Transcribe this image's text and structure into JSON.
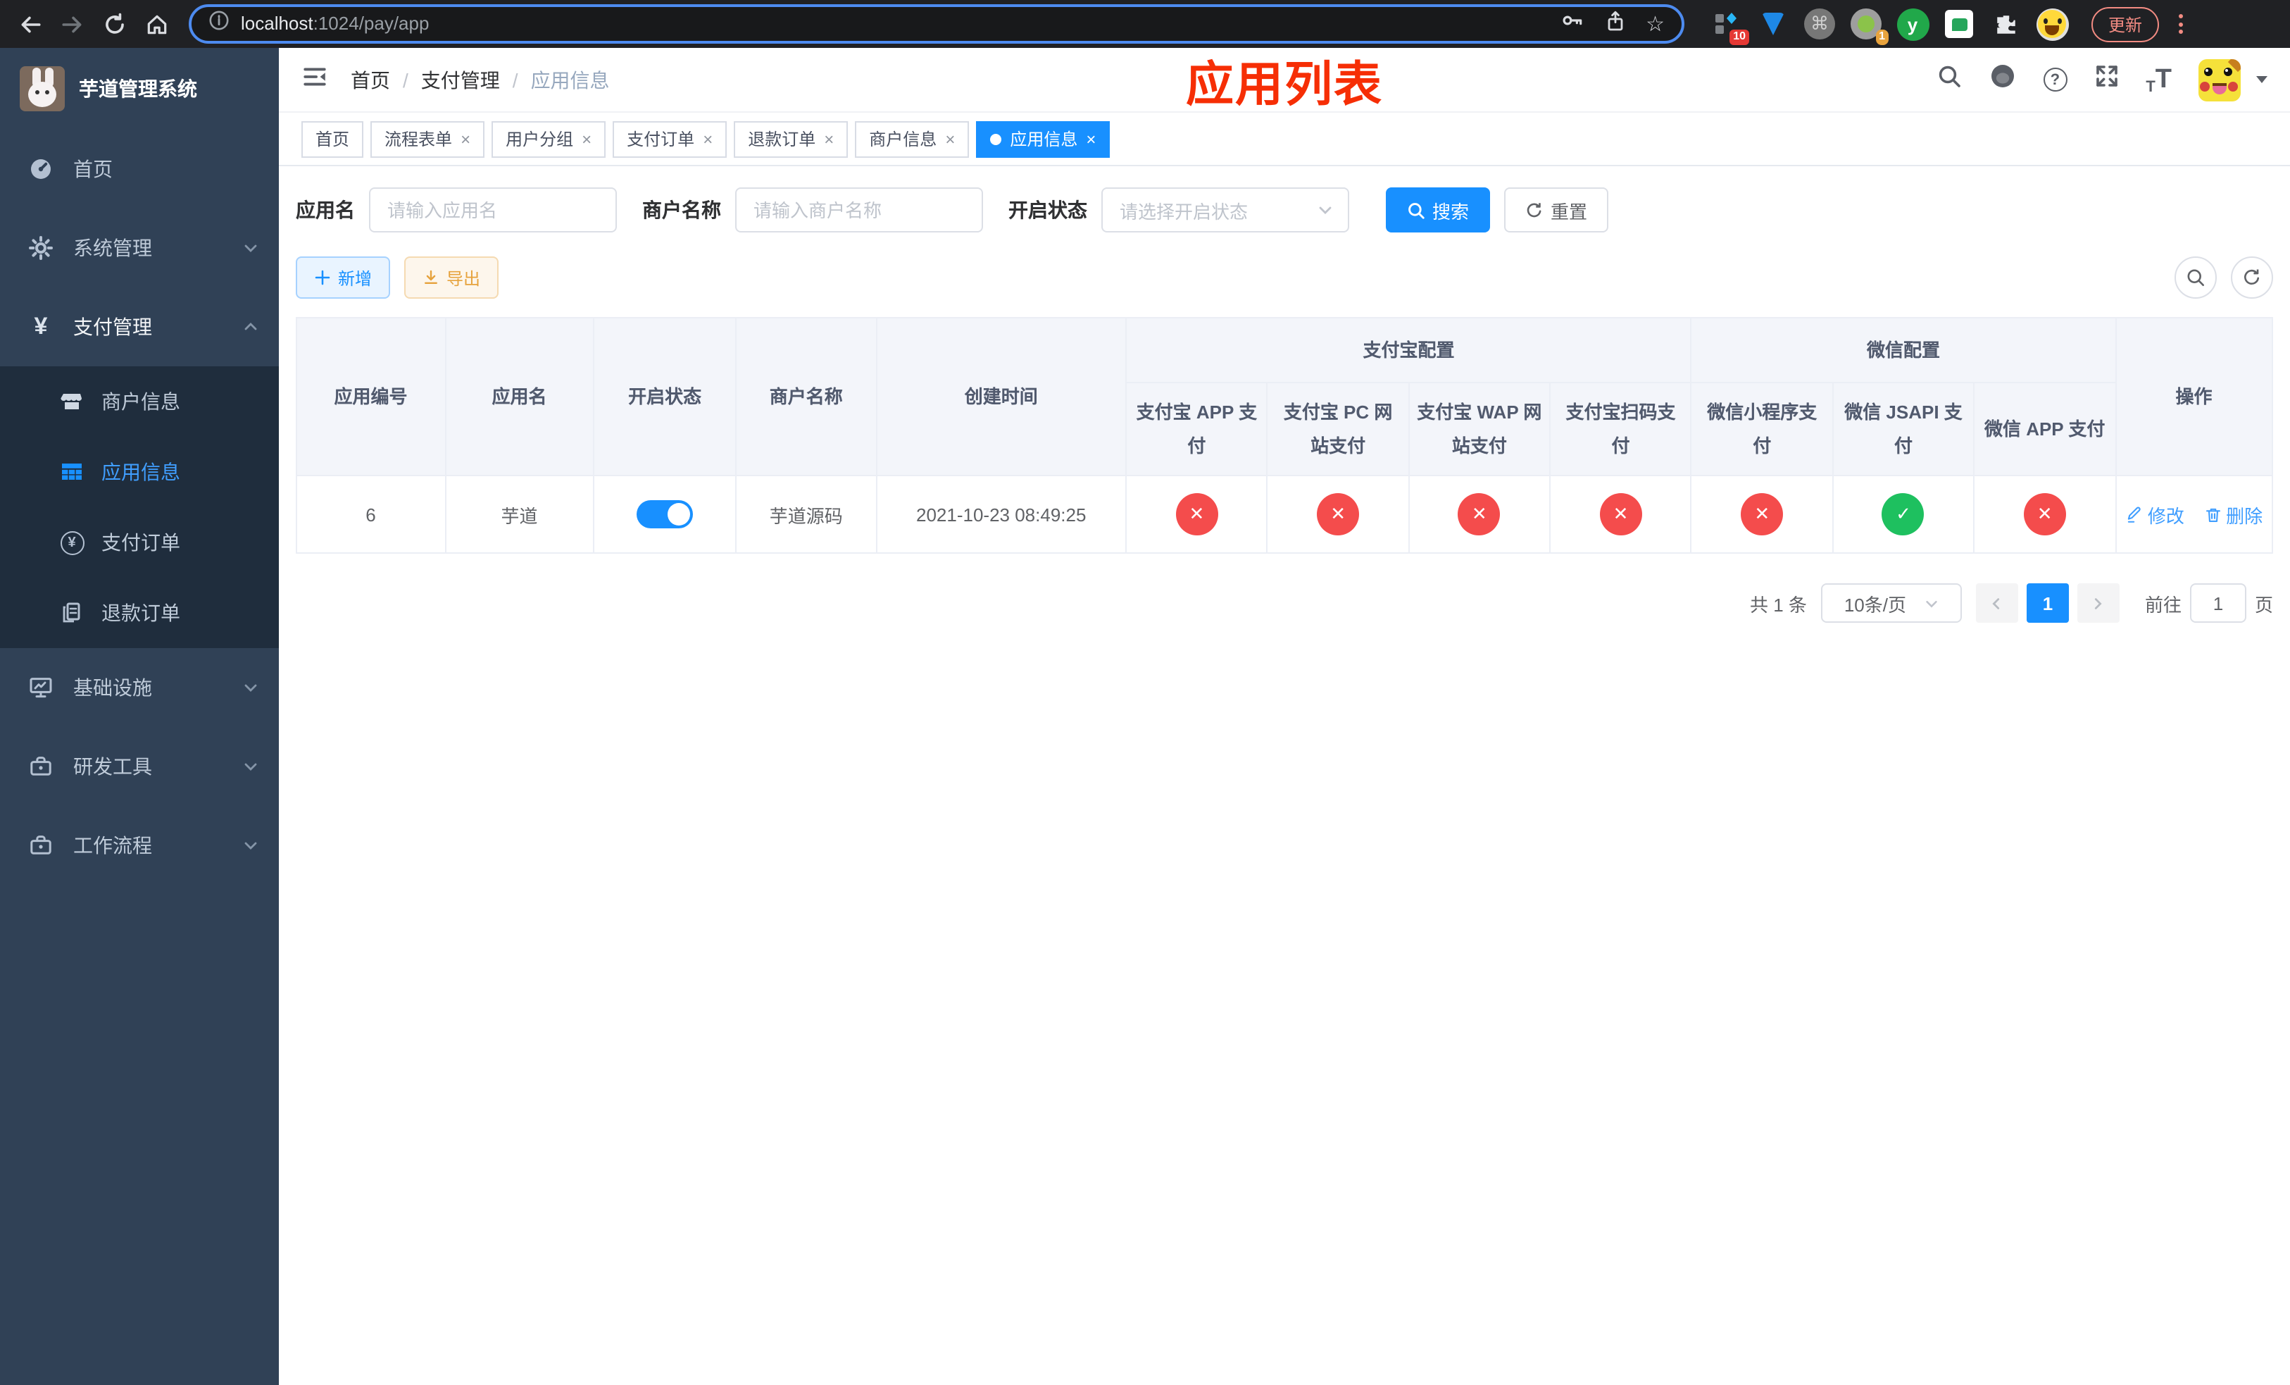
{
  "colors": {
    "accent": "#1890ff",
    "link": "#409eff",
    "danger": "#f44c4c",
    "success": "#1ec05f",
    "warning": "#e6a23c",
    "sidebar_bg": "#304156",
    "submenu_bg": "#1f2d3d",
    "title_red": "#f62e05",
    "update_red": "#f28b82"
  },
  "icons": {
    "yen": "¥",
    "question": "?",
    "command": "⌘",
    "check": "✓",
    "cross": "✕",
    "star": "☆",
    "close": "×",
    "t_small": "T",
    "t_big": "T",
    "ext_letter": "y"
  },
  "browser": {
    "url": {
      "host": "localhost",
      "path": ":1024/pay/app"
    },
    "ext_badge_10": "10",
    "ext_badge_1": "1",
    "update_label": "更新"
  },
  "sidebar": {
    "title": "芋道管理系统",
    "menu": [
      {
        "label": "首页"
      },
      {
        "label": "系统管理"
      },
      {
        "label": "支付管理"
      },
      {
        "label": "基础设施"
      },
      {
        "label": "研发工具"
      },
      {
        "label": "工作流程"
      }
    ],
    "submenu": [
      {
        "label": "商户信息"
      },
      {
        "label": "应用信息"
      },
      {
        "label": "支付订单"
      },
      {
        "label": "退款订单"
      }
    ]
  },
  "navbar": {
    "breadcrumb": [
      "首页",
      "支付管理",
      "应用信息"
    ],
    "separator": "/",
    "overlay_title": "应用列表"
  },
  "tabs": [
    {
      "label": "首页"
    },
    {
      "label": "流程表单"
    },
    {
      "label": "用户分组"
    },
    {
      "label": "支付订单"
    },
    {
      "label": "退款订单"
    },
    {
      "label": "商户信息"
    },
    {
      "label": "应用信息"
    }
  ],
  "filters": {
    "app_name_label": "应用名",
    "app_name_placeholder": "请输入应用名",
    "merchant_label": "商户名称",
    "merchant_placeholder": "请输入商户名称",
    "status_label": "开启状态",
    "status_placeholder": "请选择开启状态",
    "search_label": "搜索",
    "reset_label": "重置"
  },
  "toolbar": {
    "add_label": "新增",
    "export_label": "导出"
  },
  "table": {
    "headers": {
      "id": "应用编号",
      "name": "应用名",
      "status": "开启状态",
      "merchant": "商户名称",
      "created": "创建时间",
      "group_alipay": "支付宝配置",
      "group_wechat": "微信配置",
      "alipay_app": "支付宝 APP 支付",
      "alipay_pc": "支付宝 PC 网站支付",
      "alipay_wap": "支付宝 WAP 网站支付",
      "alipay_qr": "支付宝扫码支付",
      "wx_lite": "微信小程序支付",
      "wx_jsapi": "微信 JSAPI 支付",
      "wx_app": "微信 APP 支付",
      "actions": "操作"
    },
    "rows": [
      {
        "id": "6",
        "name": "芋道",
        "enabled": true,
        "merchant": "芋道源码",
        "created": "2021-10-23 08:49:25",
        "channels": [
          false,
          false,
          false,
          false,
          false,
          true,
          false
        ],
        "edit_label": "修改",
        "delete_label": "删除"
      }
    ]
  },
  "pagination": {
    "total_label": "共 1 条",
    "page_size": "10条/页",
    "current_page": "1",
    "goto_label": "前往",
    "goto_value": "1",
    "page_suffix": "页"
  }
}
